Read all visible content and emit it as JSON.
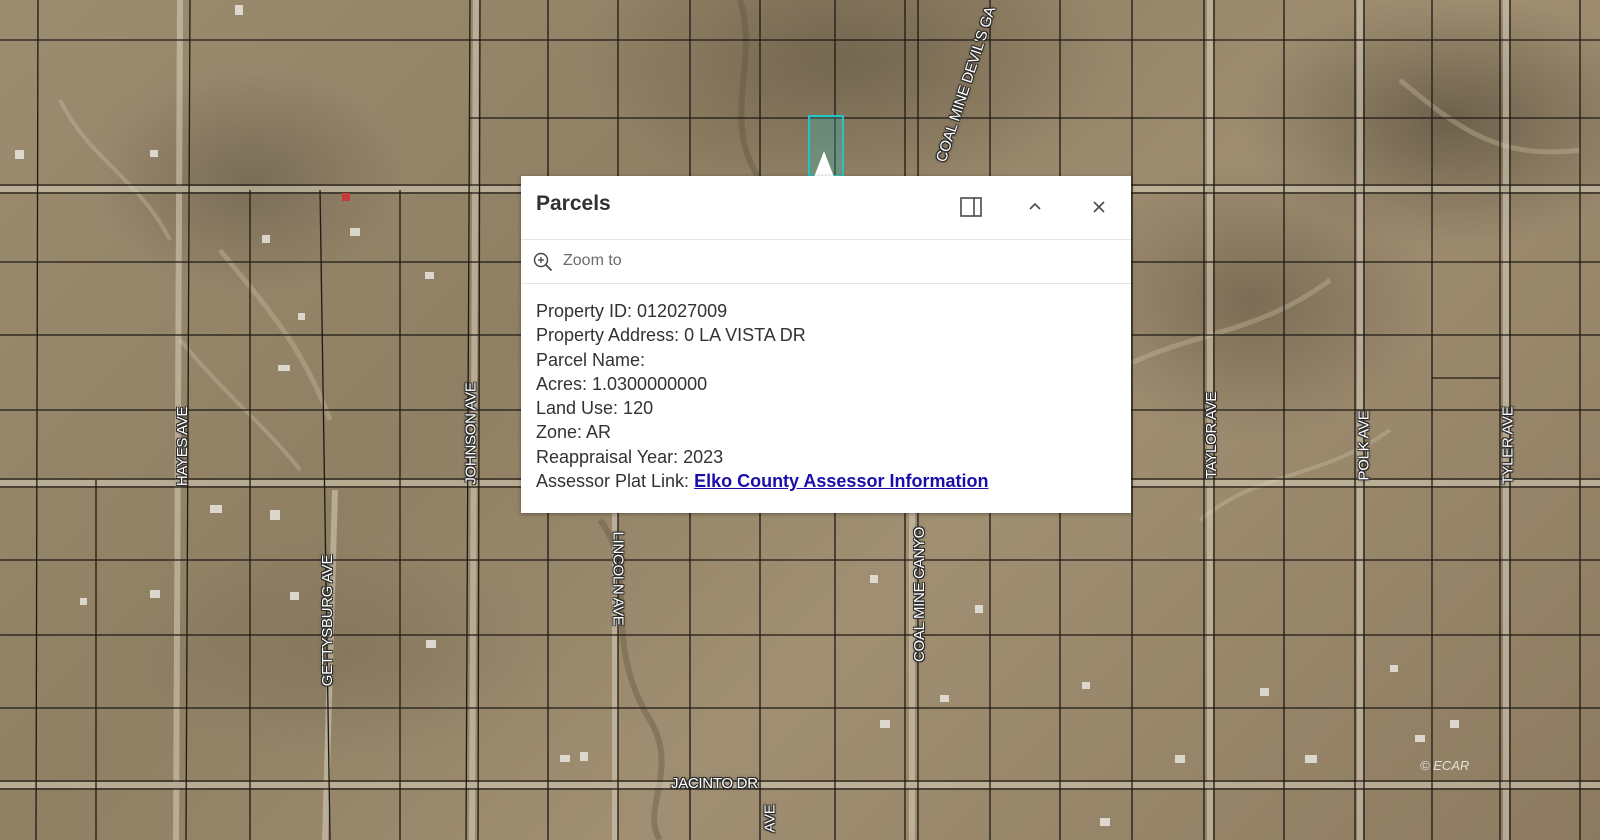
{
  "map": {
    "road_labels": {
      "hayes": "HAYES AVE",
      "johnson": "JOHNSON AVE",
      "gettysburg": "GETTYSBURG AVE",
      "lincoln": "LINCOLN AVE",
      "coal_mine_canyon": "COAL MINE CANYO",
      "coal_mine_devils": "COAL MINE DEVIL'S GA",
      "taylor": "TAYLOR AVE",
      "polk": "POLK AVE",
      "tyler": "TYLER AVE",
      "jacinto": "JACINTO DR",
      "ave_bottom": "AVE"
    },
    "attribution": "© ECAR",
    "parcel_highlight_color": "#27c3c3"
  },
  "popup": {
    "title": "Parcels",
    "dock_icon": "dock-side-icon",
    "collapse_icon": "chevron-up-icon",
    "close_icon": "close-icon",
    "zoom_icon": "zoom-in-icon",
    "zoom_label": "Zoom to",
    "attributes": {
      "property_id": "Property ID: 012027009",
      "property_address": "Property Address: 0 LA VISTA DR",
      "parcel_name": "Parcel Name:",
      "acres": "Acres: 1.0300000000",
      "land_use": "Land Use: 120",
      "zone": "Zone: AR",
      "reappraisal_year": "Reappraisal Year: 2023",
      "assessor_prefix": "Assessor Plat Link: ",
      "assessor_link": "Elko County Assessor Information"
    }
  }
}
